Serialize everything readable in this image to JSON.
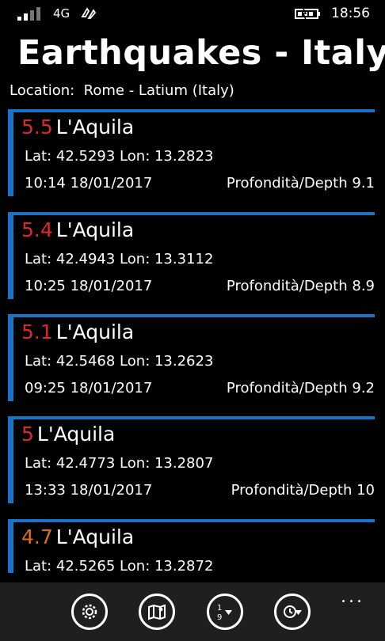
{
  "status_bar": {
    "network": "4G",
    "time": "18:56"
  },
  "header": {
    "title": "Earthquakes - Italy",
    "location_label": "Location:",
    "location_value": "Rome - Latium (Italy)"
  },
  "quakes": [
    {
      "magnitude": "5.5",
      "place": "L'Aquila",
      "coords": "Lat: 42.5293  Lon: 13.2823",
      "datetime": "10:14  18/01/2017",
      "depth": "Profondità/Depth 9.1",
      "mag_color": "#e0262a"
    },
    {
      "magnitude": "5.4",
      "place": "L'Aquila",
      "coords": "Lat: 42.4943  Lon: 13.3112",
      "datetime": "10:25  18/01/2017",
      "depth": "Profondità/Depth 8.9",
      "mag_color": "#e0262a"
    },
    {
      "magnitude": "5.1",
      "place": "L'Aquila",
      "coords": "Lat: 42.5468  Lon: 13.2623",
      "datetime": "09:25  18/01/2017",
      "depth": "Profondità/Depth 9.2",
      "mag_color": "#e0262a"
    },
    {
      "magnitude": "5",
      "place": "L'Aquila",
      "coords": "Lat: 42.4773  Lon: 13.2807",
      "datetime": "13:33  18/01/2017",
      "depth": "Profondità/Depth 10",
      "mag_color": "#e0262a"
    },
    {
      "magnitude": "4.7",
      "place": "L'Aquila",
      "coords": "Lat: 42.5265  Lon: 13.2872",
      "datetime": "",
      "depth": "",
      "mag_color": "#e06b1f"
    }
  ],
  "app_bar": {
    "buttons": [
      {
        "icon": "gear-icon"
      },
      {
        "icon": "map-icon"
      },
      {
        "icon": "sort-numeric-icon"
      },
      {
        "icon": "clock-filter-icon"
      }
    ],
    "more_label": "..."
  },
  "colors": {
    "accent": "#1a73c8",
    "magnitude_high": "#e0262a",
    "magnitude_mid": "#e06b1f",
    "appbar": "#1f1f1f"
  }
}
